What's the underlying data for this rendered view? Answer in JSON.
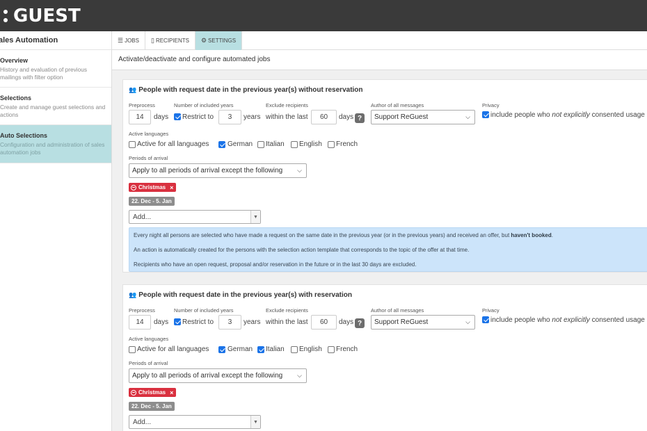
{
  "brand": {
    "logo_text": "GUEST"
  },
  "sidebar": {
    "title": "ales Automation",
    "items": [
      {
        "title": "Overview",
        "desc": "History and evaluation of previous mailings with filter option"
      },
      {
        "title": "Selections",
        "desc": "Create and manage guest selections and actions"
      },
      {
        "title": "Auto Selections",
        "desc": "Configuration and administration of sales automation jobs"
      }
    ]
  },
  "tabs": [
    {
      "icon": "list-icon",
      "label": "JOBS"
    },
    {
      "icon": "clipboard-icon",
      "label": "RECIPIENTS"
    },
    {
      "icon": "gear-icon",
      "label": "SETTINGS"
    }
  ],
  "content": {
    "heading": "Activate/deactivate and configure automated jobs"
  },
  "labels": {
    "preprocess": "Preprocess",
    "days": "days",
    "included_years": "Number of included years",
    "restrict_to": "Restrict to",
    "years": "years",
    "exclude_recipients": "Exclude recipients",
    "within_the_last": "within the last",
    "author": "Author of all messages",
    "privacy": "Privacy",
    "privacy_text_a": "include people who",
    "privacy_text_em": "not explicitly",
    "privacy_text_b": "consented usage o",
    "active_languages": "Active languages",
    "all_languages": "Active for all languages",
    "german": "German",
    "italian": "Italian",
    "english": "English",
    "french": "French",
    "periods": "Periods of arrival",
    "help": "?"
  },
  "panels": [
    {
      "title": "People with request date in the previous year(s) without reservation",
      "preprocess_days": "14",
      "years": "3",
      "exclude_days": "60",
      "author": "Support ReGuest",
      "period_mode": "Apply to all periods of arrival except the following",
      "tag": "Christmas",
      "tag_remove": "×",
      "date_range": "22. Dec - 5. Jan",
      "add_placeholder": "Add...",
      "info_1a": "Every night all persons are selected who have made a request on the same date in the previous year (or in the previous years) and received an offer, but ",
      "info_1b": "haven't booked",
      "info_1c": ".",
      "info_2": "An action is automatically created for the persons with the selection action template that corresponds to the topic of the offer at that time.",
      "info_3": "Recipients who have an open request, proposal and/or reservation in the future or in the last 30 days are excluded."
    },
    {
      "title": "People with request date in the previous year(s) with reservation",
      "preprocess_days": "14",
      "years": "3",
      "exclude_days": "60",
      "author": "Support ReGuest",
      "period_mode": "Apply to all periods of arrival except the following",
      "tag": "Christmas",
      "tag_remove": "×",
      "date_range": "22. Dec - 5. Jan",
      "add_placeholder": "Add..."
    }
  ],
  "colors": {
    "topbar": "#3a3a3a",
    "active": "#b8dfe2",
    "info_bg": "#cce4fa",
    "tag_red": "#d9303f",
    "checkbox": "#1a73e8"
  }
}
